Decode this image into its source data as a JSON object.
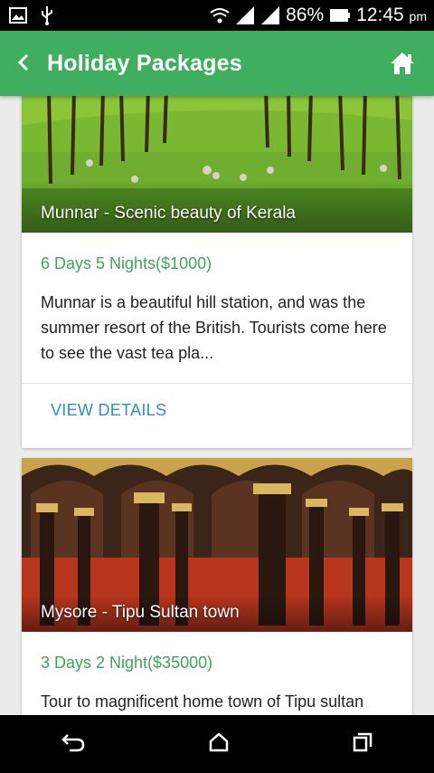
{
  "status_bar": {
    "battery": "86%",
    "time": "12:45",
    "ampm": "pm"
  },
  "app_bar": {
    "title": "Holiday Packages"
  },
  "packages": [
    {
      "caption": "Munnar - Scenic beauty of Kerala",
      "duration_price": "6 Days 5 Nights($1000)",
      "description": "Munnar is a beautiful hill station, and was the summer resort of the British. Tourists come here to see the vast tea pla...",
      "action": "VIEW DETAILS"
    },
    {
      "caption": "Mysore - Tipu Sultan town",
      "duration_price": "3 Days 2 Night($35000)",
      "description": "Tour to magnificent home town of Tipu sultan"
    }
  ],
  "colors": {
    "primary": "#3faf5f",
    "price": "#3fa45a",
    "action": "#2f8fc8"
  }
}
